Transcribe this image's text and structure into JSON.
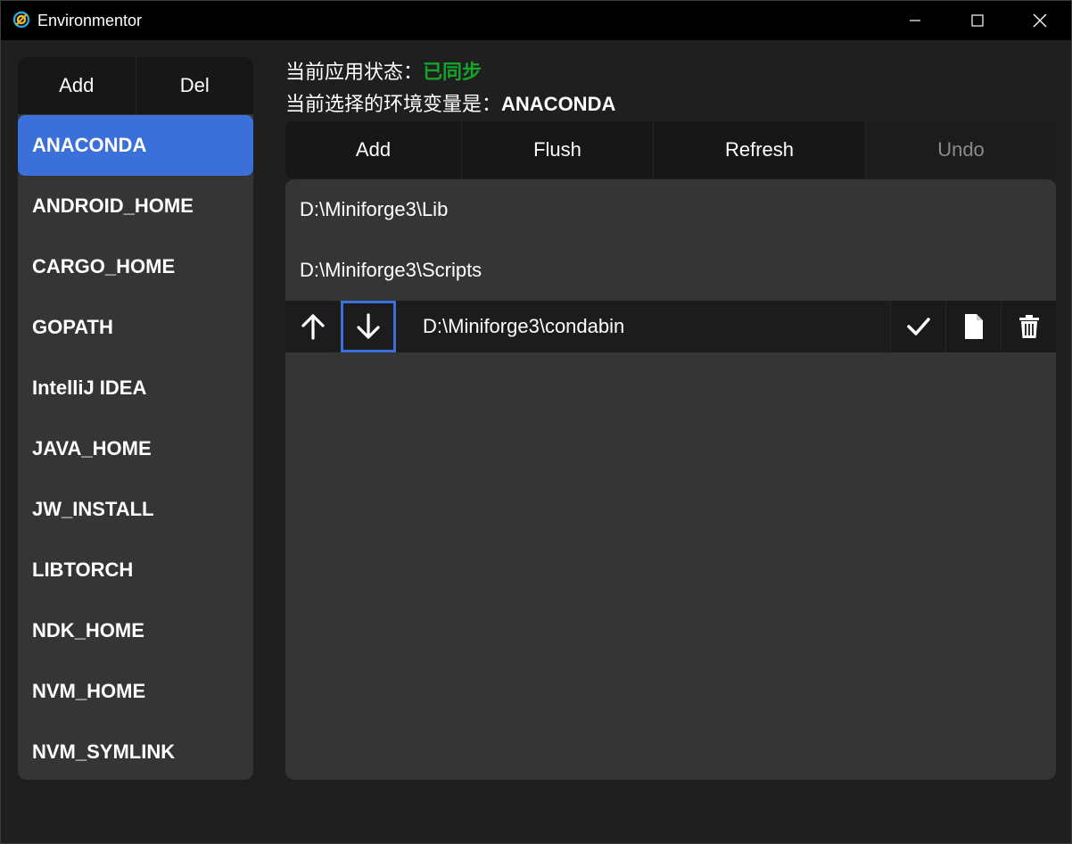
{
  "window": {
    "title": "Environmentor"
  },
  "sidebar": {
    "add_label": "Add",
    "del_label": "Del",
    "items": [
      {
        "label": "ANACONDA",
        "selected": true
      },
      {
        "label": "ANDROID_HOME",
        "selected": false
      },
      {
        "label": "CARGO_HOME",
        "selected": false
      },
      {
        "label": "GOPATH",
        "selected": false
      },
      {
        "label": "IntelliJ IDEA",
        "selected": false
      },
      {
        "label": "JAVA_HOME",
        "selected": false
      },
      {
        "label": "JW_INSTALL",
        "selected": false
      },
      {
        "label": "LIBTORCH",
        "selected": false
      },
      {
        "label": "NDK_HOME",
        "selected": false
      },
      {
        "label": "NVM_HOME",
        "selected": false
      },
      {
        "label": "NVM_SYMLINK",
        "selected": false
      }
    ]
  },
  "status": {
    "app_state_label": "当前应用状态：",
    "app_state_value": "已同步",
    "selected_var_label": "当前选择的环境变量是：",
    "selected_var_value": "ANACONDA"
  },
  "toolbar": {
    "add_label": "Add",
    "flush_label": "Flush",
    "refresh_label": "Refresh",
    "undo_label": "Undo"
  },
  "paths": {
    "items": [
      {
        "value": "D:\\Miniforge3\\Lib"
      },
      {
        "value": "D:\\Miniforge3\\Scripts"
      },
      {
        "value": "D:\\Miniforge3\\condabin"
      }
    ]
  },
  "icons": {
    "move_up": "arrow-up-icon",
    "move_down": "arrow-down-icon",
    "confirm": "check-icon",
    "file": "file-icon",
    "delete": "trash-icon"
  },
  "colors": {
    "accent": "#3b6fd9",
    "synced": "#16a32a",
    "background": "#1f1f1f",
    "panel": "#353535",
    "toolbar": "#171717"
  }
}
